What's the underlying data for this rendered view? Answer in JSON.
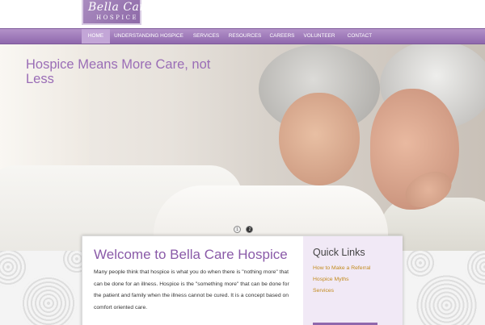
{
  "header": {
    "logo_script": "Bella Care",
    "logo_sub": "HOSPICE"
  },
  "nav": {
    "items": [
      {
        "label": "HOME",
        "active": true
      },
      {
        "label": "UNDERSTANDING HOSPICE"
      },
      {
        "label": "SERVICES"
      },
      {
        "label": "RESOURCES"
      },
      {
        "label": "CAREERS"
      },
      {
        "label": "VOLUNTEER"
      },
      {
        "label": "CONTACT"
      }
    ]
  },
  "hero": {
    "title": "Hospice Means More Care, not Less",
    "slides": [
      "1",
      "2"
    ],
    "active_slide": 2
  },
  "welcome": {
    "title": "Welcome to Bella Care Hospice",
    "body": "Many people think that hospice is what you do when there is \"nothing more\" that can be done for an illness. Hospice is the \"something more\" that can be done for the patient and family when the illness cannot be cured. It is a concept based on comfort oriented care."
  },
  "quick_links": {
    "title": "Quick Links",
    "links": [
      "How to Make a Referral",
      "Hospice Myths",
      "Services"
    ]
  },
  "colors": {
    "brand_purple": "#8f68ad",
    "title_purple": "#9a6db6",
    "link_gold": "#c28a1c",
    "quick_bg": "#f1e9f6"
  }
}
